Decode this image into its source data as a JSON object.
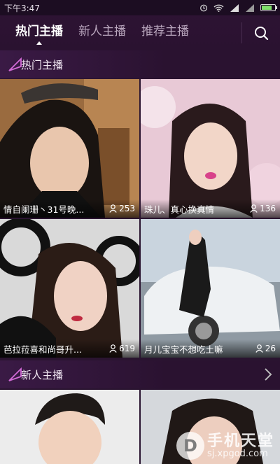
{
  "status_bar": {
    "time": "下午3:47"
  },
  "nav": {
    "tabs": [
      {
        "label": "热门主播",
        "active": true
      },
      {
        "label": "新人主播",
        "active": false
      },
      {
        "label": "推荐主播",
        "active": false
      }
    ],
    "search_icon": "search-icon"
  },
  "sections": {
    "hot": {
      "title": "热门主播"
    },
    "new": {
      "title": "新人主播"
    }
  },
  "hot_cards": [
    {
      "name": "情自阑珊丶31号晚...",
      "viewers": "253"
    },
    {
      "name": "珠儿、真心换真情",
      "viewers": "136"
    },
    {
      "name": "芭拉菈喜和尚哥升...",
      "viewers": "619"
    },
    {
      "name": "月儿宝宝不想吃土嘛",
      "viewers": "26"
    }
  ],
  "watermark": {
    "main": "手机天堂",
    "sub": "sj.xpgod.com"
  },
  "colors": {
    "background": "#2a1430",
    "accent": "#d36bd8"
  }
}
